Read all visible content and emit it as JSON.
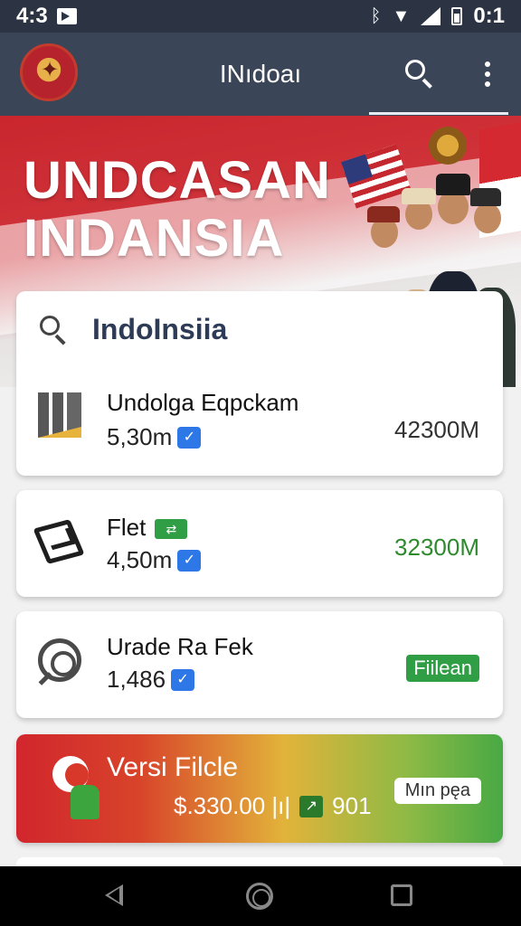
{
  "status_bar": {
    "time": "4:3",
    "clock_right": "0:1"
  },
  "app_bar": {
    "title": "INıdoaı"
  },
  "hero": {
    "title_line1": "UNDCASAN",
    "title_line2": "INDANSIA"
  },
  "search": {
    "value": "IndoInsiia"
  },
  "list": [
    {
      "title": "Undolga Eqpckam",
      "sub": "5,30m",
      "value": "42300M",
      "value_color": "#333333"
    },
    {
      "title": "Flet",
      "sub": "4,50m",
      "value": "32300M",
      "value_color": "#2f8a2f"
    },
    {
      "title": "Urade Ra Fek",
      "sub": "1,486",
      "badge": "Fiilean"
    }
  ],
  "promo": {
    "title": "Versi Filcle",
    "price": "$.330.00 |ı|",
    "trend_value": "901",
    "button": "Mın pęa"
  },
  "colors": {
    "app_bar": "#3b4558",
    "status_bar": "#2c3443",
    "accent_green": "#2f9e44",
    "check_blue": "#2d77e6"
  }
}
